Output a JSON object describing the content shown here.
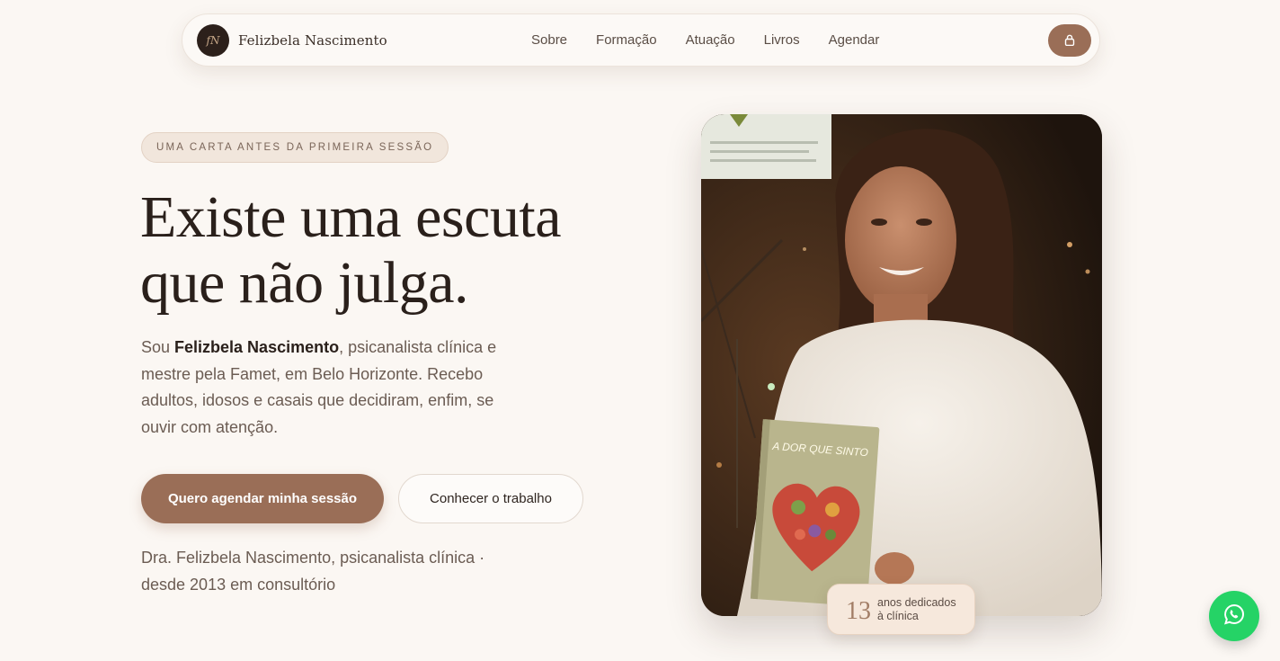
{
  "nav": {
    "brand_name": "Felizbela Nascimento",
    "brand_mark": "fN",
    "links": [
      {
        "label": "Sobre"
      },
      {
        "label": "Formação"
      },
      {
        "label": "Atuação"
      },
      {
        "label": "Livros"
      },
      {
        "label": "Agendar"
      }
    ],
    "lock_icon": "lock-icon"
  },
  "hero": {
    "eyebrow": "UMA CARTA ANTES DA PRIMEIRA SESSÃO",
    "headline_line1": "Existe uma escuta",
    "headline_line2": "que não julga.",
    "intro_prefix": "Sou ",
    "intro_name": "Felizbela Nascimento",
    "intro_suffix": ", psicanalista clínica e mestre pela Famet, em Belo Horizonte. Recebo adultos, idosos e casais que decidiram, enfim, se ouvir com atenção.",
    "cta_primary": "Quero agendar minha sessão",
    "cta_secondary": "Conhecer o trabalho",
    "credit_line1": "Dra. Felizbela Nascimento, psicanalista clínica ·",
    "credit_line2": "desde 2013 em consultório"
  },
  "photo": {
    "book_title": "A DOR QUE SINTO",
    "badge_number": "13",
    "badge_text_line1": "anos dedicados",
    "badge_text_line2": "à clínica"
  },
  "floating": {
    "whatsapp_icon": "whatsapp-icon"
  },
  "colors": {
    "background": "#fbf7f3",
    "accent": "#9a6e57",
    "text_dark": "#2a201b",
    "text_muted": "#6b5c53",
    "whatsapp": "#25d366"
  }
}
